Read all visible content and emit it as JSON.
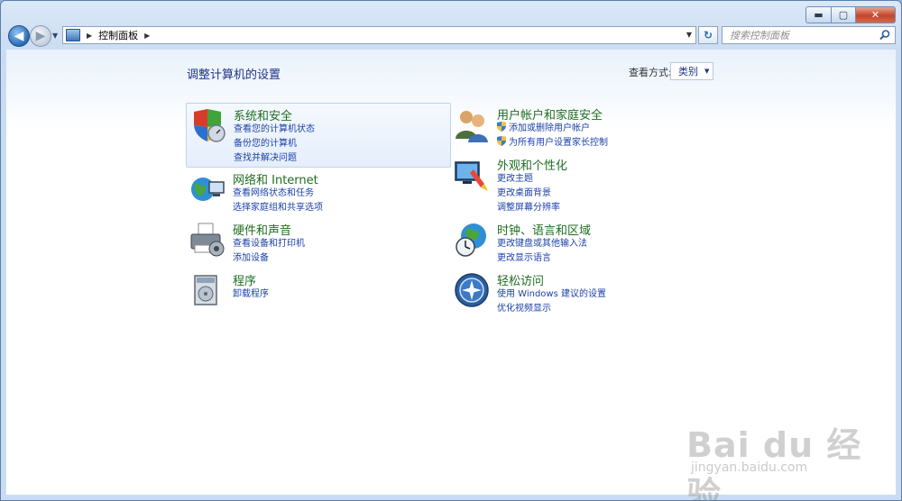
{
  "window": {
    "buttons": {
      "minimize": "▬",
      "maximize": "▢",
      "close": "✕"
    }
  },
  "address": {
    "breadcrumb": [
      "控制面板"
    ],
    "search_placeholder": "搜索控制面板"
  },
  "page": {
    "title": "调整计算机的设置",
    "view_by_label": "查看方式:",
    "view_by_value": "类别"
  },
  "categories": [
    {
      "title": "系统和安全",
      "icon": "shield-icon",
      "links": [
        "查看您的计算机状态",
        "备份您的计算机",
        "查找并解决问题"
      ]
    },
    {
      "title": "用户帐户和家庭安全",
      "icon": "users-icon",
      "links": [
        "添加或删除用户帐户",
        "为所有用户设置家长控制"
      ]
    },
    {
      "title": "网络和 Internet",
      "icon": "network-icon",
      "links": [
        "查看网络状态和任务",
        "选择家庭组和共享选项"
      ]
    },
    {
      "title": "外观和个性化",
      "icon": "appearance-icon",
      "links": [
        "更改主题",
        "更改桌面背景",
        "调整屏幕分辨率"
      ]
    },
    {
      "title": "硬件和声音",
      "icon": "printer-icon",
      "links": [
        "查看设备和打印机",
        "添加设备"
      ]
    },
    {
      "title": "时钟、语言和区域",
      "icon": "clock-globe-icon",
      "links": [
        "更改键盘或其他输入法",
        "更改显示语言"
      ]
    },
    {
      "title": "程序",
      "icon": "programs-icon",
      "links": [
        "卸载程序"
      ]
    },
    {
      "title": "轻松访问",
      "icon": "ease-of-access-icon",
      "links": [
        "使用 Windows 建议的设置",
        "优化视频显示"
      ]
    }
  ],
  "watermark": {
    "brand": "Bai du 经验",
    "url": "jingyan.baidu.com"
  },
  "colors": {
    "category_title": "#1f6e21",
    "link": "#1c42a8",
    "page_title": "#1e3287"
  }
}
